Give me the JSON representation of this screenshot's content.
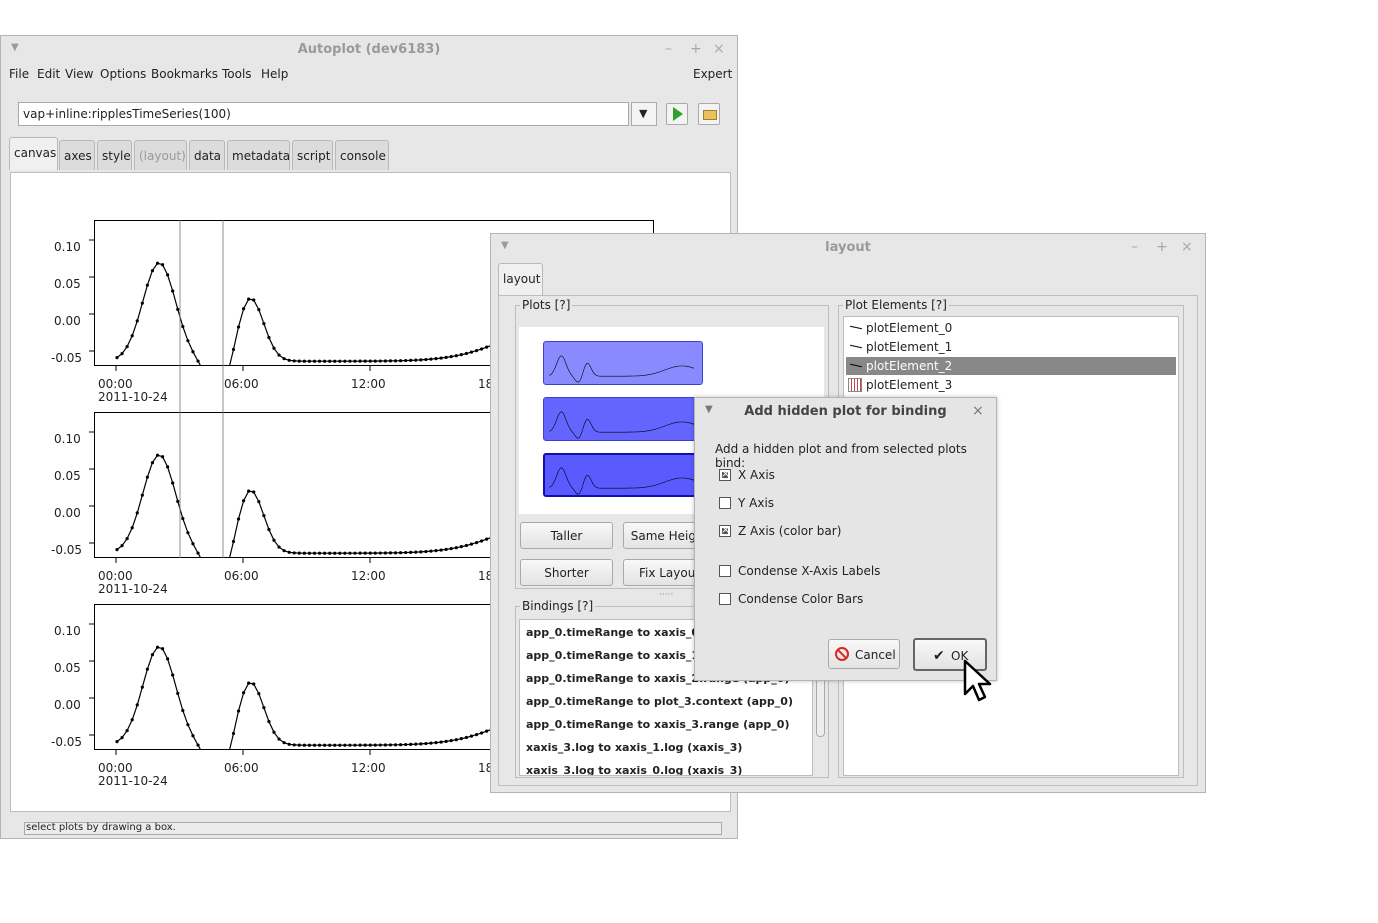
{
  "main": {
    "title": "Autoplot (dev6183)",
    "menus": [
      "File",
      "Edit",
      "View",
      "Options",
      "Bookmarks",
      "Tools",
      "Help"
    ],
    "expert": "Expert",
    "uri": "vap+inline:ripplesTimeSeries(100)",
    "tabs": [
      "canvas",
      "axes",
      "style",
      "(layout)",
      "data",
      "metadata",
      "script",
      "console"
    ],
    "status": "select plots by drawing a box."
  },
  "plots": {
    "yticks": [
      "0.10",
      "0.05",
      "0.00",
      "-0.05"
    ],
    "xticks": [
      "00:00",
      "06:00",
      "12:00",
      "18:00"
    ],
    "date": "2011-10-24"
  },
  "layout_window": {
    "title": "layout",
    "tab": "layout",
    "plots_group": "Plots [?]",
    "elements_group": "Plot Elements [?]",
    "bindings_group": "Bindings [?]",
    "buttons": {
      "taller": "Taller",
      "same_height": "Same Height",
      "shorter": "Shorter",
      "fix_layout": "Fix Layout"
    },
    "elements": [
      "plotElement_0",
      "plotElement_1",
      "plotElement_2",
      "plotElement_3"
    ],
    "bindings": [
      "app_0.timeRange to xaxis_0.range  (app_0)",
      "app_0.timeRange to xaxis_1.range  (app_0)",
      "app_0.timeRange to xaxis_2.range  (app_0)",
      "app_0.timeRange to plot_3.context  (app_0)",
      "app_0.timeRange to xaxis_3.range  (app_0)",
      "xaxis_3.log to xaxis_1.log  (xaxis_3)",
      "xaxis_3.log to xaxis_0.log  (xaxis_3)"
    ]
  },
  "dialog": {
    "title": "Add hidden plot for binding",
    "prompt": "Add a hidden plot and from selected plots bind:",
    "options": [
      {
        "label": "X Axis",
        "checked": true
      },
      {
        "label": "Y Axis",
        "checked": false
      },
      {
        "label": "Z Axis (color bar)",
        "checked": true
      },
      {
        "label": "Condense X-Axis Labels",
        "checked": false
      },
      {
        "label": "Condense Color Bars",
        "checked": false
      }
    ],
    "cancel": "Cancel",
    "ok": "OK"
  },
  "colors": {
    "selection": "#888888",
    "plot_preview": "#6464ff",
    "ok_icon": "#222222",
    "cancel_icon": "#d9281e",
    "play_icon": "#2ea02e"
  }
}
